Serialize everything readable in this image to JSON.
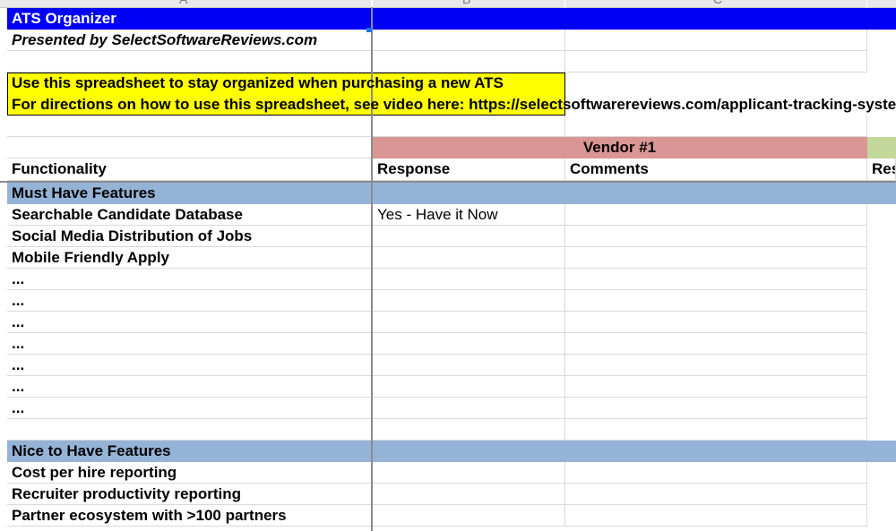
{
  "sheet": {
    "column_headers": [
      "A",
      "B",
      "C"
    ],
    "title": "ATS Organizer",
    "subtitle": "Presented by SelectSoftwareReviews.com",
    "note_line1": "Use this spreadsheet to stay organized when purchasing a new ATS",
    "note_line2": "For directions on how to use this spreadsheet, see video here: https://selectsoftwarereviews.com/applicant-tracking-system",
    "vendor_label": "Vendor #1",
    "headers": {
      "functionality": "Functionality",
      "response": "Response",
      "comments": "Comments",
      "response_next": "Res"
    },
    "must_have_section": "Must Have Features",
    "must_have_items": [
      {
        "feature": "Searchable Candidate Database",
        "response": "Yes - Have it Now"
      },
      {
        "feature": "Social Media Distribution of Jobs",
        "response": ""
      },
      {
        "feature": "Mobile Friendly Apply",
        "response": ""
      },
      {
        "feature": "...",
        "response": ""
      },
      {
        "feature": "...",
        "response": ""
      },
      {
        "feature": "...",
        "response": ""
      },
      {
        "feature": "...",
        "response": ""
      },
      {
        "feature": "...",
        "response": ""
      },
      {
        "feature": "...",
        "response": ""
      },
      {
        "feature": "...",
        "response": ""
      }
    ],
    "nice_to_have_section": "Nice to Have Features",
    "nice_to_have_items": [
      {
        "feature": "Cost per hire reporting"
      },
      {
        "feature": "Recruiter productivity reporting"
      },
      {
        "feature": "Partner ecosystem with >100 partners"
      }
    ]
  },
  "colors": {
    "title_bg": "#0000f5",
    "note_bg": "#ffff00",
    "vendor_bg": "#da9694",
    "section_bg": "#95b3d7",
    "next_vendor_bg": "#c4d79b"
  }
}
